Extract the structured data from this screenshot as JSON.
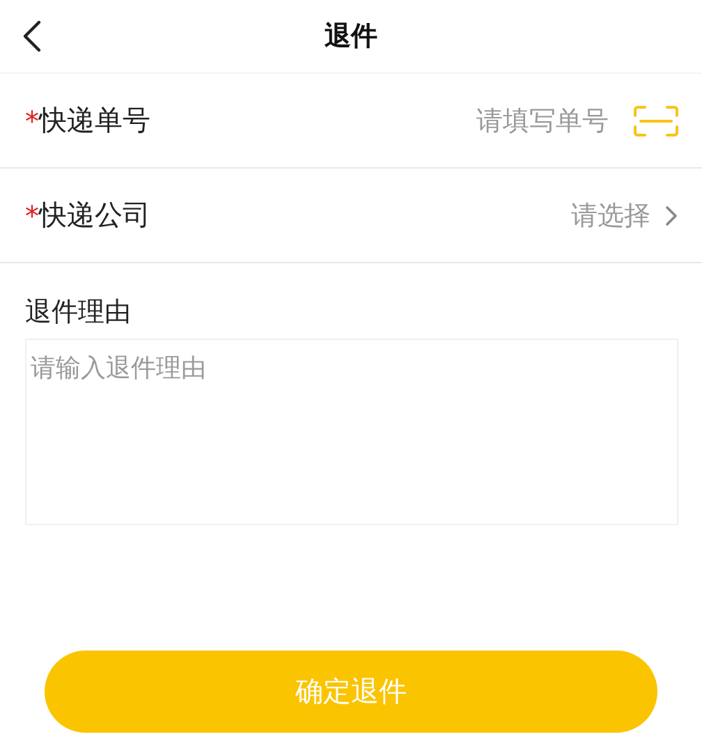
{
  "header": {
    "title": "退件"
  },
  "fields": [
    {
      "kind": "scan",
      "marker": "*",
      "label": "快递单号",
      "placeholder": "请填写单号"
    },
    {
      "kind": "select",
      "marker": "*",
      "label": "快递公司",
      "placeholder": "请选择"
    }
  ],
  "reason": {
    "label": "退件理由",
    "placeholder": "请输入退件理由"
  },
  "submit": {
    "label": "确定退件"
  }
}
